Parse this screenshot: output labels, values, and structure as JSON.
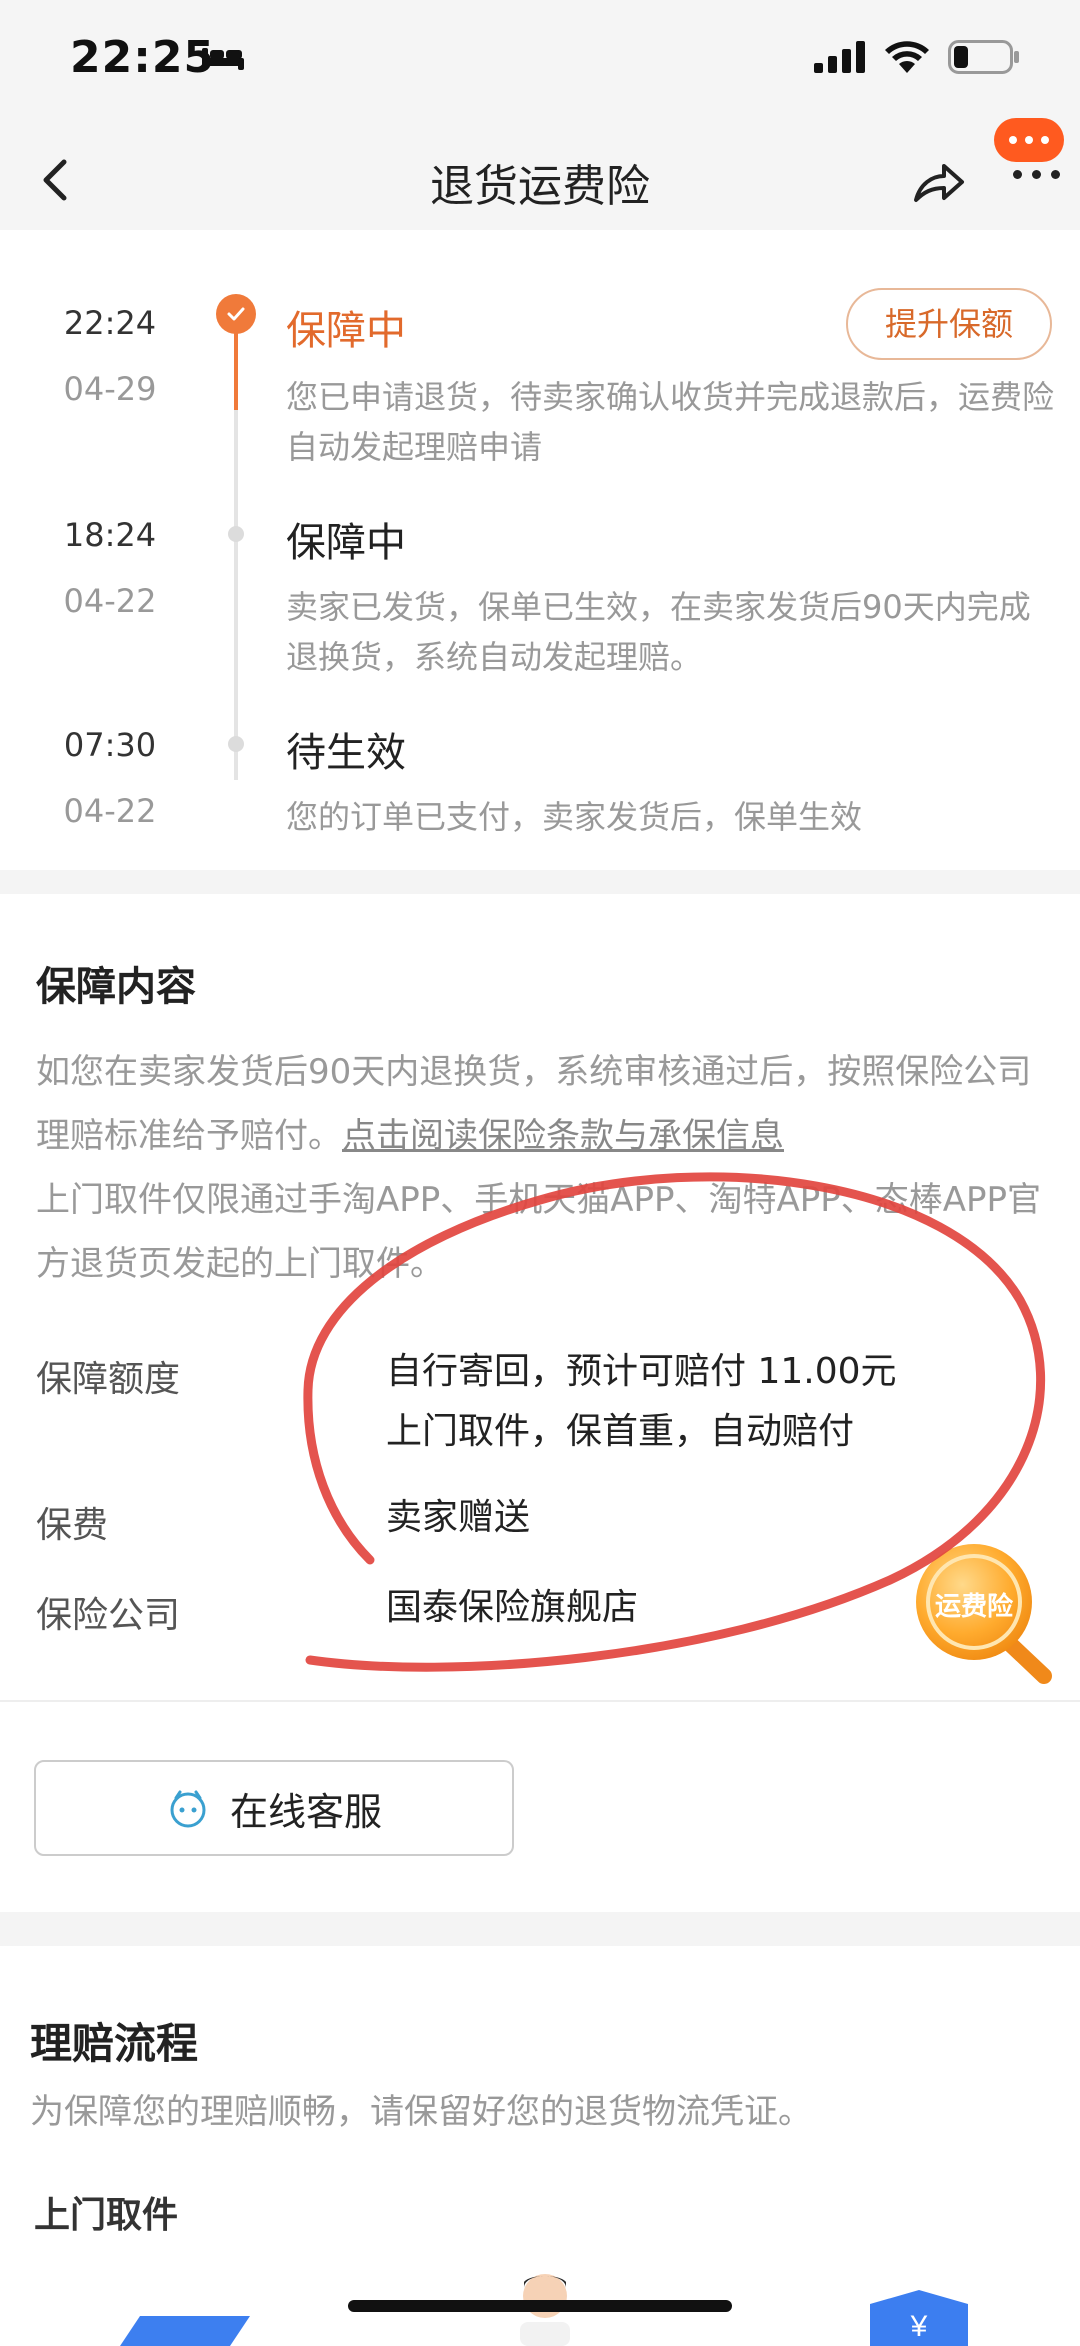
{
  "status_bar": {
    "time": "22:25"
  },
  "nav": {
    "title": "退货运费险"
  },
  "timeline": [
    {
      "time": "22:24",
      "date": "04-29",
      "status": "保障中",
      "desc": "您已申请退货，待卖家确认收货并完成退款后，运费险自动发起理赔申请",
      "active": true
    },
    {
      "time": "18:24",
      "date": "04-22",
      "status": "保障中",
      "desc": "卖家已发货，保单已生效，在卖家发货后90天内完成退换货，系统自动发起理赔。",
      "active": false
    },
    {
      "time": "07:30",
      "date": "04-22",
      "status": "待生效",
      "desc": "您的订单已支付，卖家发货后，保单生效",
      "active": false
    }
  ],
  "upgrade_button": "提升保额",
  "coverage": {
    "title": "保障内容",
    "desc_part1": "如您在卖家发货后90天内退换货，系统审核通过后，按照保险公司理赔标准给予赔付。",
    "desc_link": "点击阅读保险条款与承保信息",
    "desc_part2": "上门取件仅限通过手淘APP、手机天猫APP、淘特APP、态棒APP官方退货页发起的上门取件。",
    "rows": [
      {
        "label": "保障额度",
        "value_line1": "自行寄回，预计可赔付 11.00元",
        "value_line2": "上门取件，保首重，自动赔付"
      },
      {
        "label": "保费",
        "value_line1": "卖家赠送"
      },
      {
        "label": "保险公司",
        "value_line1": "国泰保险旗舰店"
      }
    ],
    "badge_text": "运费险"
  },
  "customer_service": {
    "label": "在线客服"
  },
  "claims": {
    "title": "理赔流程",
    "subtitle": "为保障您的理赔顺畅，请保留好您的退货物流凭证。",
    "pickup_title": "上门取件"
  },
  "colors": {
    "accent": "#e26a2c",
    "ink_circle": "#e2453f"
  }
}
